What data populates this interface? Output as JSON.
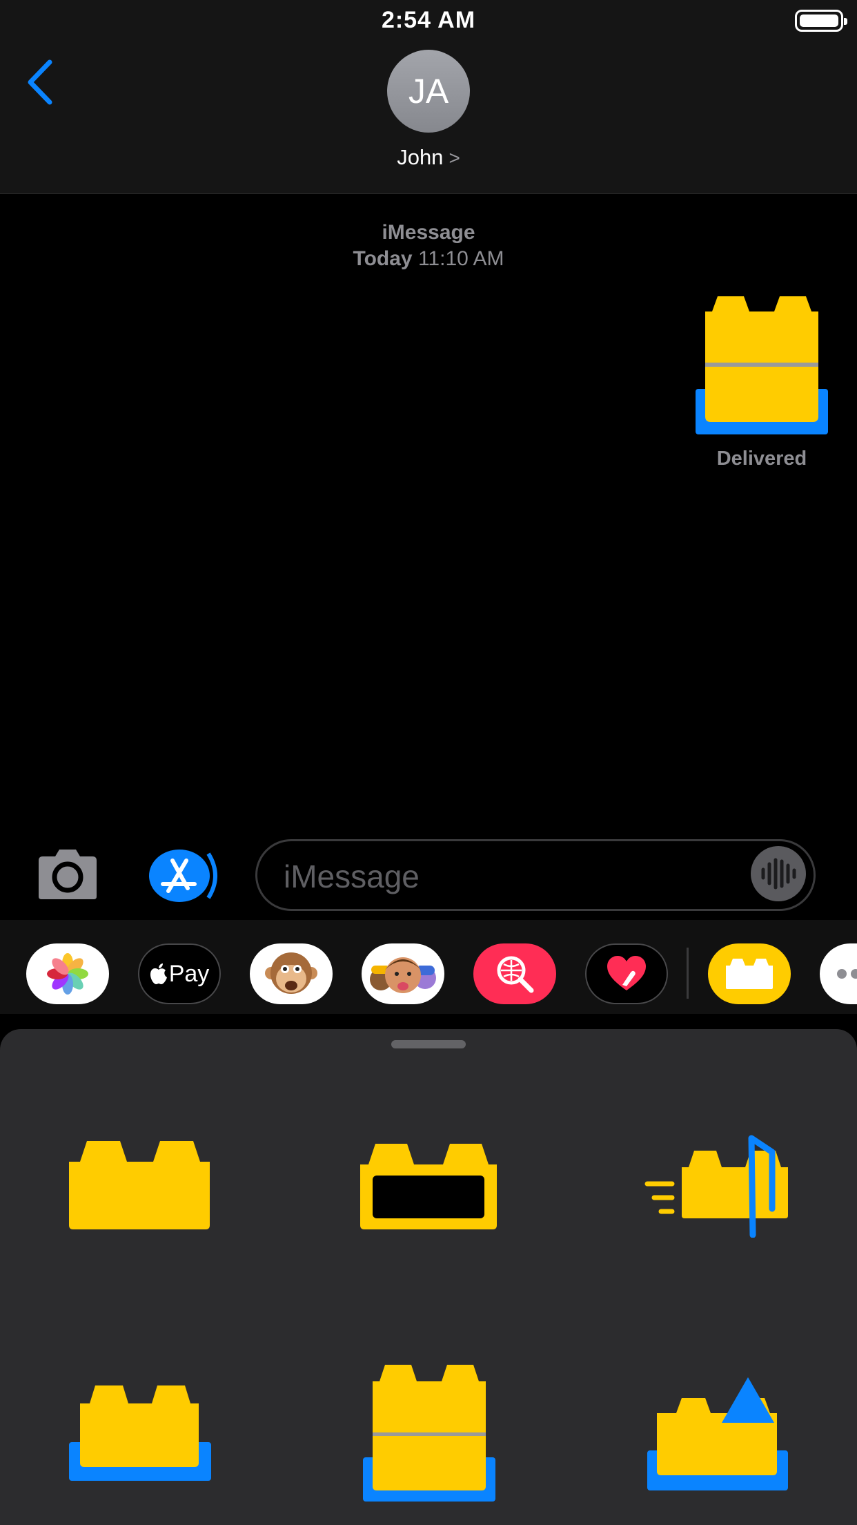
{
  "status_bar": {
    "time": "2:54 AM"
  },
  "header": {
    "avatar_initials": "JA",
    "contact_name": "John",
    "contact_chevron": ">"
  },
  "conversation": {
    "service": "iMessage",
    "timestamp_day": "Today",
    "timestamp_time": "11:10 AM",
    "message_status": "Delivered"
  },
  "composer": {
    "placeholder": "iMessage"
  },
  "app_drawer": {
    "apple_pay_label": "Pay",
    "apps": [
      "photos-icon",
      "apple-pay-icon",
      "animoji-icon",
      "memoji-icon",
      "image-search-icon",
      "digital-touch-icon",
      "block-stickers-icon",
      "more-icon"
    ]
  },
  "colors": {
    "accent_blue": "#0a84ff",
    "sticker_yellow": "#ffcc00",
    "background": "#000000",
    "panel": "#2c2c2e"
  }
}
